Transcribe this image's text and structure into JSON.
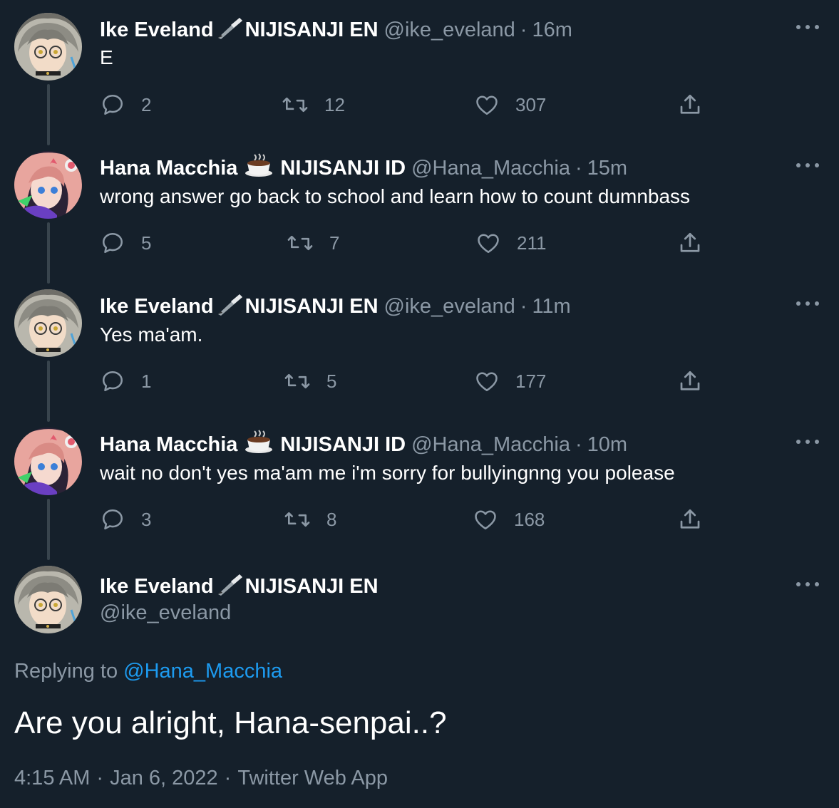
{
  "colors": {
    "background": "#15202b",
    "text_primary": "#ffffff",
    "text_secondary": "#8b98a5",
    "link": "#1d9bf0",
    "thread_line": "#38444d"
  },
  "icons": {
    "reply": "speech-bubble-icon",
    "retweet": "retweet-arrows-icon",
    "like": "heart-icon",
    "share": "share-upload-icon",
    "more": "three-dots-icon",
    "quill": "quill-pen-emoji",
    "coffee": "coffee-cup-emoji"
  },
  "tweets": [
    {
      "name": "Ike Eveland",
      "affiliation": "NIJISANJI EN",
      "handle": "@ike_eveland",
      "sep": "·",
      "time": "16m",
      "text": "E",
      "replies": "2",
      "retweets": "12",
      "likes": "307"
    },
    {
      "name": "Hana Macchia",
      "affiliation": "NIJISANJI ID",
      "handle": "@Hana_Macchia",
      "sep": "·",
      "time": "15m",
      "text": "wrong answer go back to school and learn how to count dumnbass",
      "replies": "5",
      "retweets": "7",
      "likes": "211"
    },
    {
      "name": "Ike Eveland",
      "affiliation": "NIJISANJI EN",
      "handle": "@ike_eveland",
      "sep": "·",
      "time": "11m",
      "text": "Yes ma'am.",
      "replies": "1",
      "retweets": "5",
      "likes": "177"
    },
    {
      "name": "Hana Macchia",
      "affiliation": "NIJISANJI ID",
      "handle": "@Hana_Macchia",
      "sep": "·",
      "time": "10m",
      "text": "wait no don't yes ma'am me i'm sorry for bullyingnng you polease",
      "replies": "3",
      "retweets": "8",
      "likes": "168"
    }
  ],
  "main_tweet": {
    "name": "Ike Eveland",
    "affiliation": "NIJISANJI EN",
    "handle": "@ike_eveland",
    "replying_prefix": "Replying to",
    "replying_handle": "@Hana_Macchia",
    "text": "Are you alright, Hana-senpai..?",
    "time": "4:15 AM",
    "date": "Jan 6, 2022",
    "client": "Twitter Web App",
    "sep": "·"
  }
}
